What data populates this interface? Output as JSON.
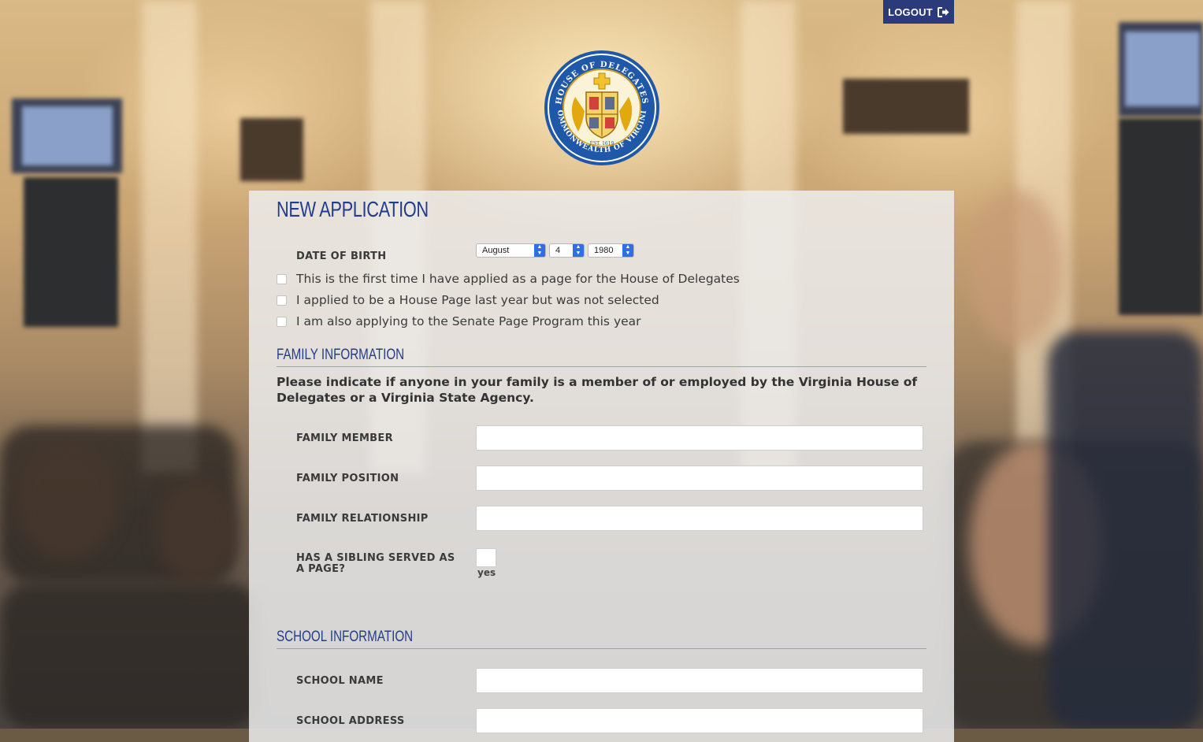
{
  "header": {
    "logout_label": "LOGOUT",
    "logout_icon": "sign-out-icon"
  },
  "seal": {
    "top_text": "HOUSE OF DELEGATES",
    "bottom_text": "COMMONWEALTH OF VIRGINIA",
    "est_text": "EST. 1619"
  },
  "form": {
    "title": "NEW APPLICATION",
    "dob": {
      "label": "DATE OF BIRTH",
      "month": "August",
      "day": "4",
      "year": "1980"
    },
    "checkboxes": [
      {
        "label": "This is the first time I have applied as a page for the House of Delegates",
        "checked": false
      },
      {
        "label": "I applied to be a House Page last year but was not selected",
        "checked": false
      },
      {
        "label": "I am also applying to the Senate Page Program this year",
        "checked": false
      }
    ],
    "family": {
      "heading": "FAMILY INFORMATION",
      "instructions": "Please indicate if anyone in your family is a member of or employed by the Virginia House of Delegates or a Virginia State Agency.",
      "member_label": "FAMILY MEMBER",
      "member_value": "",
      "position_label": "FAMILY POSITION",
      "position_value": "",
      "relationship_label": "FAMILY RELATIONSHIP",
      "relationship_value": "",
      "sibling_label": "HAS A SIBLING SERVED AS A PAGE?",
      "sibling_option": "yes"
    },
    "school": {
      "heading": "SCHOOL INFORMATION",
      "name_label": "SCHOOL NAME",
      "name_value": "",
      "address_label": "SCHOOL ADDRESS",
      "address_value": ""
    }
  },
  "colors": {
    "accent": "#233c8c",
    "logout_bg": "#2a3a7a",
    "select_arrow": "#2f6fe0"
  }
}
